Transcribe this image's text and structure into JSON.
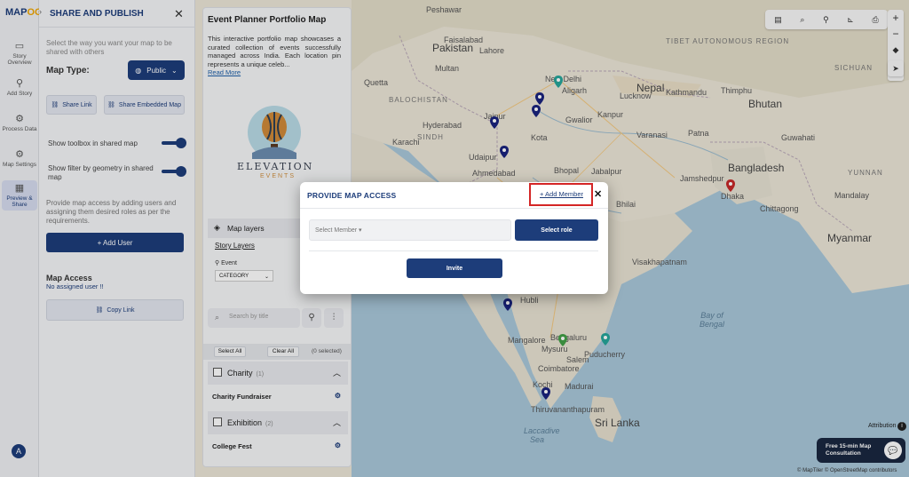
{
  "app": {
    "logo_main": "MAP",
    "logo_accent": "OG"
  },
  "rail": [
    {
      "label": "Story Overview",
      "icon": "book-icon"
    },
    {
      "label": "Add Story",
      "icon": "pin-icon"
    },
    {
      "label": "Process Data",
      "icon": "gear-icon"
    },
    {
      "label": "Map Settings",
      "icon": "settings-icon"
    },
    {
      "label": "Preview & Share",
      "icon": "share-icon"
    }
  ],
  "avatar_letter": "A",
  "share_panel": {
    "title": "SHARE AND PUBLISH",
    "description": "Select the way you want your map to be shared with others",
    "map_type_label": "Map Type:",
    "map_type_value": "Public",
    "share_link": "Share Link",
    "share_embedded": "Share Embedded Map",
    "toggle_toolbox": "Show toolbox in shared map",
    "toggle_filter": "Show filter by geometry in shared map",
    "access_description": "Provide map access by adding users and assigning them desired roles as per the requirements.",
    "add_user": "+ Add User",
    "map_access_title": "Map Access",
    "no_user": "No assigned user !!",
    "copy_link": "Copy Link"
  },
  "story": {
    "title": "Event Planner Portfolio Map",
    "description": "This interactive portfolio map showcases a curated collection of events successfully managed across India. Each location pin represents a unique celeb...",
    "read_more": "Read More",
    "brand_name": "ELEVATION",
    "brand_sub": "EVENTS",
    "layers_header": "Map layers",
    "story_layers": "Story Layers",
    "event_label": "Event",
    "category_select": "CATEGORY",
    "search_placeholder": "Search by title",
    "select_all": "Select All",
    "clear_all": "Clear All",
    "selected_count": "(0 selected)",
    "groups": [
      {
        "name": "Charity",
        "count": "(1)",
        "item": "Charity Fundraiser"
      },
      {
        "name": "Exhibition",
        "count": "(2)",
        "item": "College Fest"
      }
    ]
  },
  "map_labels": {
    "pakistan": "Pakistan",
    "nepal": "Nepal",
    "bhutan": "Bhutan",
    "bangladesh": "Bangladesh",
    "myanmar": "Myanmar",
    "sri_lanka": "Sri Lanka",
    "new_delhi": "New Delhi",
    "kathmandu": "Kathmandu",
    "thimphu": "Thimphu",
    "aligarh": "Aligarh",
    "jaipur": "Jaipur",
    "gwalior": "Gwalior",
    "kanpur": "Kanpur",
    "lucknow": "Lucknow",
    "varanasi": "Varanasi",
    "patna": "Patna",
    "kota": "Kota",
    "karachi": "Karachi",
    "ahmedabad": "Ahmedabad",
    "bhopal": "Bhopal",
    "jabalpur": "Jabalpur",
    "jamshedpur": "Jamshedpur",
    "bhilai": "Bhilai",
    "visakhapatnam": "Visakhapatnam",
    "hubli": "Hubli",
    "bengaluru": "Bengaluru",
    "mangalore": "Mangalore",
    "mysuru": "Mysuru",
    "salem": "Salem",
    "puducherry": "Puducherry",
    "coimbatore": "Coimbatore",
    "madurai": "Madurai",
    "kochi": "Kochi",
    "thiruvananthapuram": "Thiruvananthapuram",
    "bay_of_bengal": "Bay of Bengal",
    "laccadive_sea": "Laccadive Sea",
    "lahore": "Lahore",
    "faisalabad": "Faisalabad",
    "multan": "Multan",
    "quetta": "Quetta",
    "balochistan": "BALOCHISTAN",
    "sindh": "SINDH",
    "hyderabad": "Hyderabad",
    "peshawar": "Peshawar",
    "tibet": "TIBET AUTONOMOUS REGION",
    "sichuan": "SICHUAN",
    "yunnan": "YUNNAN",
    "dhaka": "Dhaka",
    "chittagong": "Chittagong",
    "mandalay": "Mandalay",
    "udaipur": "Udaipur",
    "guwahati": "Guwahati"
  },
  "map_controls": {
    "attribution": "Attribution",
    "consult_line1": "Free 15-min Map",
    "consult_line2": "Consultation",
    "copyright": "© MapTiler © OpenStreetMap contributors"
  },
  "modal": {
    "title": "PROVIDE MAP ACCESS",
    "add_member": "+ Add Member",
    "select_member": "Select Member",
    "select_role": "Select role",
    "invite": "Invite"
  },
  "colors": {
    "primary": "#1d3d7a",
    "highlight_border": "#d42626",
    "pin_blue": "#1a237e",
    "pin_red": "#c62828",
    "pin_teal": "#26a69a",
    "pin_green": "#43a047"
  }
}
